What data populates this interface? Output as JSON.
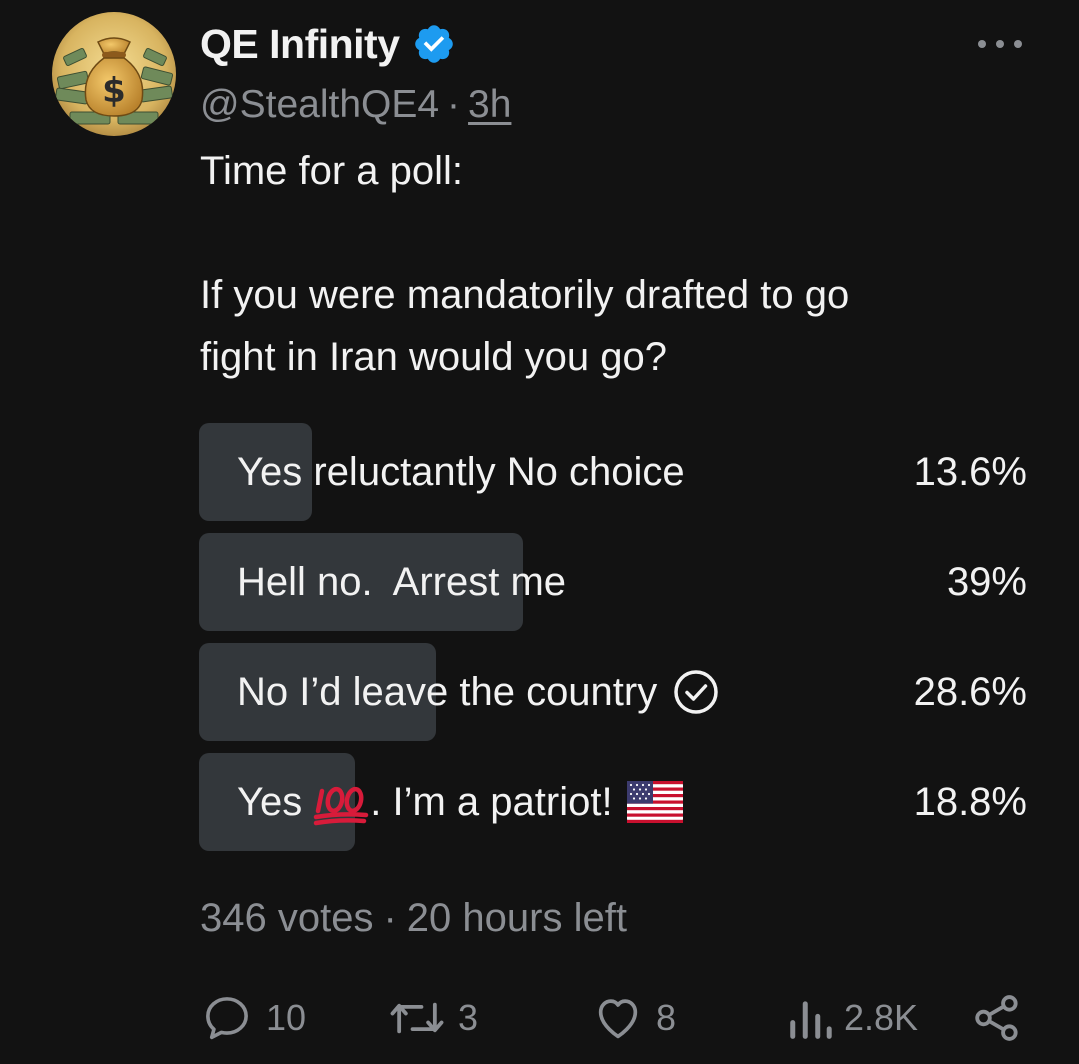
{
  "post": {
    "author_name": "QE Infinity",
    "handle": "@StealthQE4",
    "separator": "·",
    "time_ago": "3h",
    "text_line1": "Time for a poll:",
    "text_line2": "If you were mandatorily drafted to go",
    "text_line3": "fight in Iran would you go?"
  },
  "poll": {
    "options": [
      {
        "label": "Yes reluctantly No choice",
        "percent_text": "13.6%",
        "percent": 13.6
      },
      {
        "label": "Hell no.  Arrest me",
        "percent_text": "39%",
        "percent": 39
      },
      {
        "label": "No I’d leave the country",
        "percent_text": "28.6%",
        "percent": 28.6,
        "voted": true
      },
      {
        "label_before": "Yes",
        "label_after": ". I’m a patriot!",
        "percent_text": "18.8%",
        "percent": 18.8
      }
    ],
    "votes": "346 votes",
    "separator": "·",
    "time_left": "20 hours left"
  },
  "actions": {
    "replies": "10",
    "reposts": "3",
    "likes": "8",
    "views": "2.8K"
  },
  "icons": {
    "verified": "verified-badge-icon",
    "more": "more-dots-icon",
    "check": "check-circle-icon",
    "hundred": "hundred-points-emoji-icon",
    "flag": "us-flag-emoji-icon",
    "reply": "reply-icon",
    "repost": "repost-icon",
    "like": "heart-icon",
    "views": "views-icon",
    "share": "share-icon"
  },
  "colors": {
    "background": "#121212",
    "verified": "#1d9bf0",
    "poll_bar": "#33373b",
    "muted_text": "#8b8e93",
    "primary_text": "#f2f2f2"
  }
}
